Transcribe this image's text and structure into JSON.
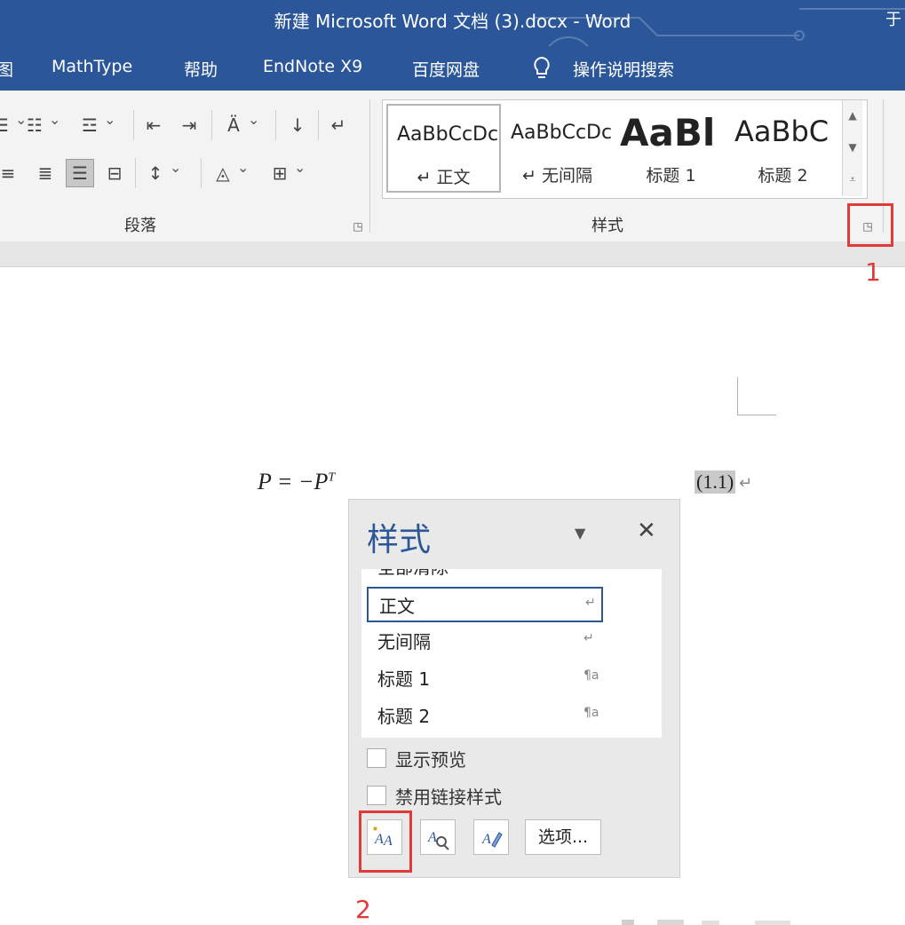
{
  "window": {
    "title": "新建 Microsoft Word 文档 (3).docx  -  Word",
    "right_cut": "于"
  },
  "tabs": [
    {
      "label": "图"
    },
    {
      "label": "MathType"
    },
    {
      "label": "帮助"
    },
    {
      "label": "EndNote X9"
    },
    {
      "label": "百度网盘"
    },
    {
      "label": "操作说明搜索"
    }
  ],
  "ribbon": {
    "paragraph_label": "段落",
    "styles_label": "样式",
    "gallery": [
      {
        "sample": "AaBbCcDc",
        "name": "↵ 正文"
      },
      {
        "sample": "AaBbCcDc",
        "name": "↵ 无间隔"
      },
      {
        "sample": "AaBl",
        "name": "标题 1"
      },
      {
        "sample": "AaBbC",
        "name": "标题 2"
      }
    ]
  },
  "annotations": {
    "one": "1",
    "two": "2"
  },
  "document": {
    "equation_main": "P = −P",
    "equation_sup": "T",
    "equation_number": "(1.1)",
    "para_mark": "↵"
  },
  "styles_pane": {
    "title": "样式",
    "items": [
      {
        "name": "全部清除",
        "mark": ""
      },
      {
        "name": "正文",
        "mark": "↵"
      },
      {
        "name": "无间隔",
        "mark": "↵"
      },
      {
        "name": "标题 1",
        "mark": "¶a"
      },
      {
        "name": "标题 2",
        "mark": "¶a"
      }
    ],
    "show_preview": "显示预览",
    "disable_linked": "禁用链接样式",
    "options": "选项..."
  },
  "colors": {
    "word_blue": "#2b579a",
    "highlight_red": "#e03a3a",
    "pane_title_blue": "#2b5797"
  }
}
